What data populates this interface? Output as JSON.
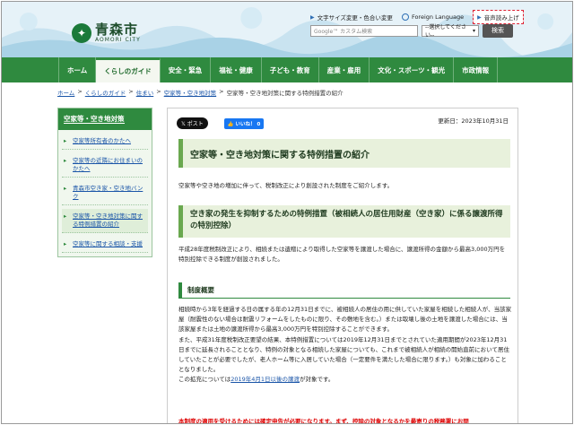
{
  "header": {
    "logo_ja": "青森市",
    "logo_en": "AOMORI CITY",
    "links": {
      "font_size_color": "文字サイズ変更・色合い変更",
      "foreign_language": "Foreign Language",
      "voice": "音声読み上げ"
    },
    "search": {
      "placeholder": "Google™ カスタム検索",
      "brand": "Google",
      "select_value": "--選択してください--",
      "button": "検索"
    }
  },
  "nav": {
    "items": [
      {
        "label": "ホーム"
      },
      {
        "label": "くらしのガイド"
      },
      {
        "label": "安全・緊急"
      },
      {
        "label": "福祉・健康"
      },
      {
        "label": "子ども・教育"
      },
      {
        "label": "産業・雇用"
      },
      {
        "label": "文化・スポーツ・観光"
      },
      {
        "label": "市政情報"
      }
    ]
  },
  "breadcrumb": {
    "items": [
      "ホーム",
      "くらしのガイド",
      "住まい",
      "空家等・空き地対策"
    ],
    "current": "空家等・空き地対策に関する特例措置の紹介",
    "separator": ">"
  },
  "sidebar": {
    "title": "空家等・空き地対策",
    "items": [
      {
        "label": "空家等所有者のかたへ"
      },
      {
        "label": "空家等の近隣にお住まいのかたへ"
      },
      {
        "label": "青森市空き家・空き地バンク"
      },
      {
        "label": "空家等・空き地対策に関する特例措置の紹介"
      },
      {
        "label": "空家等に関する相談・支援"
      }
    ]
  },
  "main": {
    "share_x": "ポスト",
    "share_fb": "いいね！ 0",
    "updated": "更新日：2023年10月31日",
    "title": "空家等・空き地対策に関する特例措置の紹介",
    "intro": "空家等や空き地の増加に伴って、税制改正により創設された制度をご紹介します。",
    "section_title": "空き家の発生を抑制するための特例措置（被相続人の居住用財産（空き家）に係る譲渡所得の特別控除）",
    "section_para": "平成28年度税制改正により、相続または遺贈により取得した空家等を譲渡した場合に、譲渡所得の金額から最高3,000万円を特別控除できる制度が創設されました。",
    "subsection_title": "制度概要",
    "body_1": "相続時から3年を経過する日の属する年の12月31日までに、被相続人の居住の用に供していた家屋を相続した相続人が、当該家屋（耐震性のない場合は耐震リフォームをしたものに限り、その敷地を含む。）または取壊し後の土地を譲渡した場合には、当該家屋または土地の譲渡所得から最高3,000万円を特別控除することができます。",
    "body_2": "また、平成31年度税制改正要望の結果、本特例措置については2019年12月31日までとされていた適用期間が2023年12月31日までに延長されることとなり、特例の対象となる相続した家屋についても、これまで被相続人が相続の開始直前において居住していたことが必要でしたが、老人ホーム等に入居していた場合（一定要件を満たした場合に限ります。）も対象に加わることとなりました。",
    "body_3_pre": "この拡充については",
    "body_3_link": "2019年4月1日以後の譲渡",
    "body_3_post": "が対象です。",
    "note": "本制度の適用を受けるためには確定申告が必要になります。まず、控除の対象となるかを最寄りの税務署にお問"
  },
  "colors": {
    "nav_green": "#2f8a3f",
    "heading_bg": "#e8f1dc",
    "link_blue": "#1a55a8",
    "note_red": "#dd0000"
  }
}
